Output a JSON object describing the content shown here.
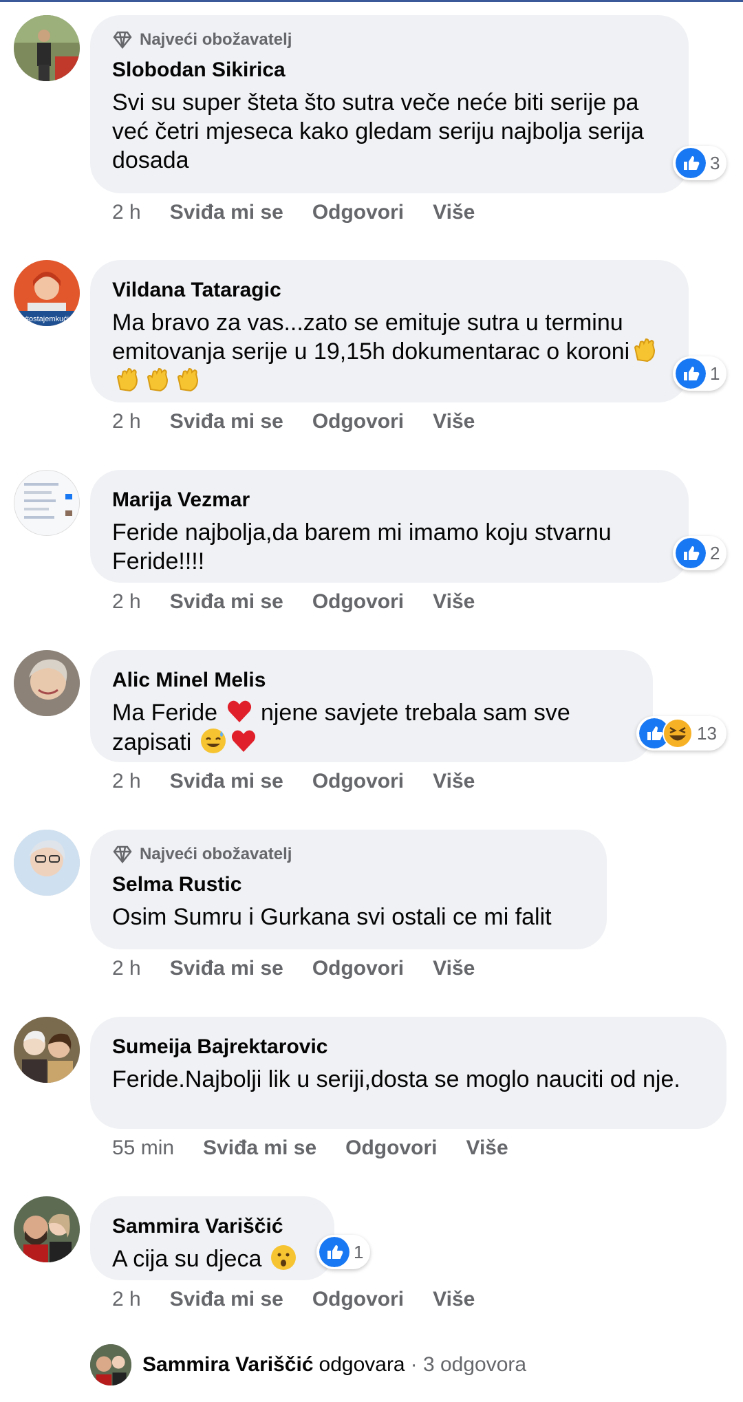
{
  "fan_badge": "Najveći obožavatelj",
  "actions": {
    "like": "Sviđa mi se",
    "reply": "Odgovori",
    "more": "Više"
  },
  "comments": [
    {
      "name": "Slobodan Sikirica",
      "fan": true,
      "text": "Svi su super šteta što sutra veče neće biti serije pa već četri mjeseca kako gledam seriju najbolja serija dosada",
      "time": "2 h",
      "reactions": "3"
    },
    {
      "name": "Vildana Tataragic",
      "fan": false,
      "text": "Ma bravo za vas...zato se emituje sutra u terminu emitovanja serije u 19,15h dokumentarac o koroni",
      "time": "2 h",
      "reactions": "1",
      "emoji_suffix": [
        "clap",
        "clap",
        "clap",
        "clap"
      ],
      "avatar_tag": "#ostajemkući"
    },
    {
      "name": "Marija Vezmar",
      "fan": false,
      "text": "Feride najbolja,da barem mi imamo koju stvarnu Feride!!!!",
      "time": "2 h",
      "reactions": "2"
    },
    {
      "name": "Alic Minel Melis",
      "fan": false,
      "text_a": "Ma Feride",
      "text_b": "njene savjete trebala sam sve zapisati",
      "time": "2 h",
      "reactions": "13"
    },
    {
      "name": "Selma Rustic",
      "fan": true,
      "text": "Osim Sumru i Gurkana svi ostali ce mi falit",
      "time": "2 h"
    },
    {
      "name": "Sumeija Bajrektarovic",
      "fan": false,
      "text": "Feride.Najbolji lik u seriji,dosta se moglo nauciti od nje.",
      "time": "55 min"
    },
    {
      "name": "Sammira Variščić",
      "fan": false,
      "text": "A cija su djeca",
      "time": "2 h",
      "reactions": "1"
    }
  ],
  "reply_summary": {
    "name": "Sammira Variščić",
    "verb": "odgovara",
    "count": "· 3 odgovora"
  },
  "colors": {
    "bubble": "#eff1f4",
    "secondary_text": "#65676b",
    "like_blue": "#1877f2",
    "top_bar": "#3b5998"
  }
}
